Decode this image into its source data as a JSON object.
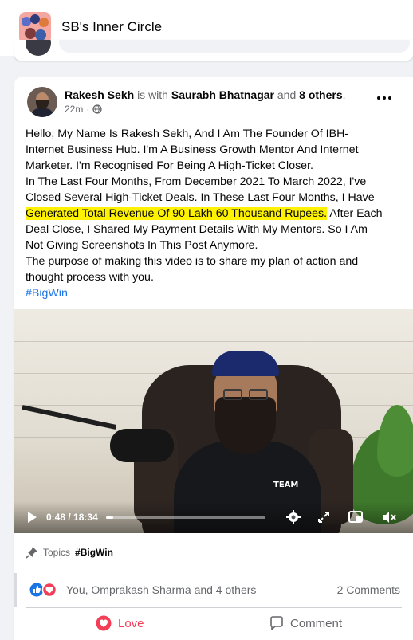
{
  "header": {
    "group_name": "SB's Inner Circle",
    "group_avatar_icon": "group-cover-icon"
  },
  "post": {
    "author": "Rakesh Sekh",
    "with_text": "is with",
    "tagged_person": "Saurabh Bhatnagar",
    "and_text": "and",
    "others_text": "8 others",
    "period": ".",
    "timestamp": "22m",
    "audience_icon": "globe-icon",
    "more_icon": "more-options-icon",
    "body_lines": [
      "Hello, My Name Is Rakesh Sekh, And I Am The Founder Of IBH-",
      "Internet Business Hub. I'm A Business Growth Mentor And Internet",
      "Marketer. I'm Recognised For Being A High-Ticket Closer.",
      "In The Last Four Months, From December 2021 To March 2022, I've",
      "Closed Several High-Ticket Deals. In These Last Four Months, I Have"
    ],
    "highlight_text": "Generated Total Revenue Of 90 Lakh 60 Thousand Rupees.",
    "after_highlight": " After Each",
    "body_lines_after": [
      "Deal Close, I Shared My Payment Details With My Mentors. So I Am",
      "Not Giving Screenshots In This Post Anymore.",
      "The purpose of making this video is to share my plan of action and",
      "thought process with you."
    ],
    "hashtag": "#BigWin",
    "highlight_color": "#fff200"
  },
  "video": {
    "current_time": "0:48",
    "separator": " / ",
    "duration": "18:34",
    "progress_fraction": 0.043,
    "shirt_text": "TEAM",
    "controls": [
      "play-icon",
      "settings-icon",
      "fullscreen-icon",
      "picture-in-picture-icon",
      "mute-icon"
    ]
  },
  "topics": {
    "label": "Topics",
    "tag": "#BigWin",
    "icon": "pin-icon"
  },
  "reactions": {
    "summary": "You, Omprakash Sharma and 4 others",
    "comments": "2 Comments",
    "icons": [
      "like-icon",
      "love-icon"
    ]
  },
  "actions": {
    "love_label": "Love",
    "comment_label": "Comment",
    "love_color": "#f33e58",
    "link_color": "#1b74e4"
  }
}
